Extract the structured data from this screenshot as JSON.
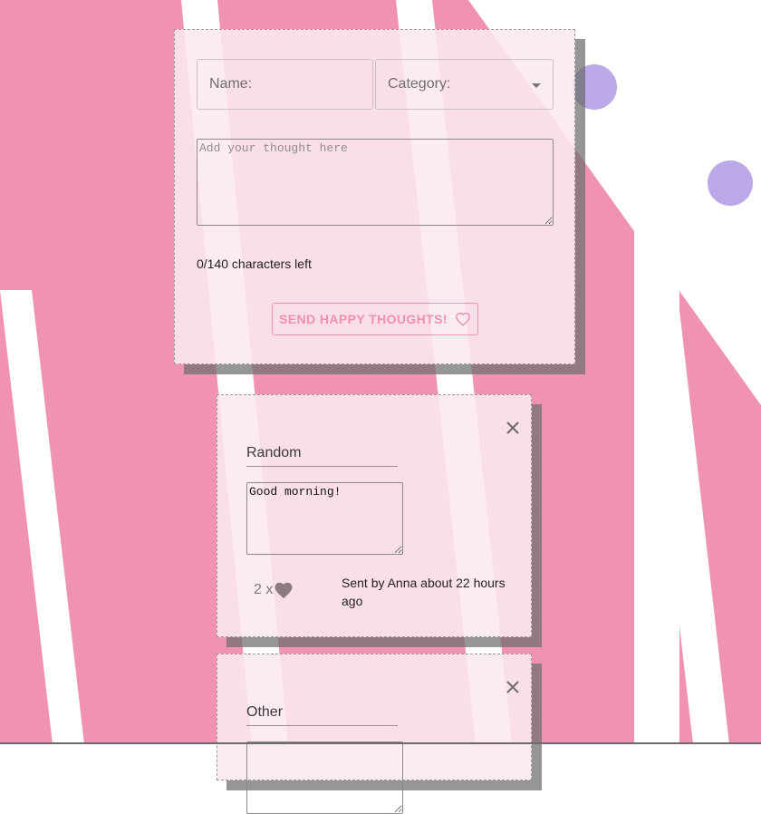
{
  "form": {
    "name_label": "Name:",
    "category_label": "Category:",
    "thought_placeholder": "Add your thought here",
    "char_counter": "0/140 characters left",
    "send_label": "SEND HAPPY THOUGHTS!"
  },
  "thoughts": [
    {
      "category": "Random",
      "message": "Good morning!",
      "like_count": "2 x",
      "meta": "Sent by Anna about 22 hours ago"
    },
    {
      "category": "Other"
    }
  ],
  "colors": {
    "background_pink": "#f093b1",
    "card_tint": "#fce9ef",
    "accent_pink": "#ef8fb4",
    "bubble_purple": "#bba8e6",
    "like_heart": "#8c7b7e"
  },
  "icons": {
    "send": "heart-outline-icon",
    "like": "heart-filled-icon",
    "close": "close-icon",
    "dropdown": "triangle-down-icon"
  }
}
